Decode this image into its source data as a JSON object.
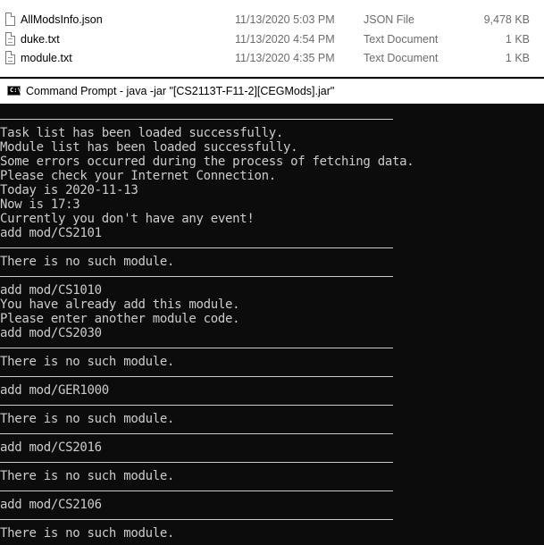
{
  "explorer": {
    "header_stub": "",
    "files": [
      {
        "name": "AllModsInfo.json",
        "modified": "11/13/2020 5:03 PM",
        "type": "JSON File",
        "size": "9,478 KB",
        "icon": "file-icon"
      },
      {
        "name": "duke.txt",
        "modified": "11/13/2020 4:54 PM",
        "type": "Text Document",
        "size": "1 KB",
        "icon": "text-file-icon"
      },
      {
        "name": "module.txt",
        "modified": "11/13/2020 4:35 PM",
        "type": "Text Document",
        "size": "1 KB",
        "icon": "text-file-icon"
      }
    ]
  },
  "window": {
    "title": "Command Prompt - java  -jar \"[CS2113T-F11-2][CEGMods].jar\"",
    "icon_text": "C:\\",
    "icon": "command-prompt-icon"
  },
  "console": {
    "lines": [
      {
        "kind": "sep",
        "text": ""
      },
      {
        "kind": "text",
        "text": "Task list has been loaded successfully."
      },
      {
        "kind": "text",
        "text": "Module list has been loaded successfully."
      },
      {
        "kind": "text",
        "text": "Some errors occurred during the process of fetching data."
      },
      {
        "kind": "text",
        "text": "Please check your Internet Connection."
      },
      {
        "kind": "text",
        "text": "Today is 2020-11-13"
      },
      {
        "kind": "text",
        "text": "Now is 17:3"
      },
      {
        "kind": "text",
        "text": "Currently you don't have any event!"
      },
      {
        "kind": "text",
        "text": "add mod/CS2101"
      },
      {
        "kind": "sep",
        "text": ""
      },
      {
        "kind": "text",
        "text": "There is no such module."
      },
      {
        "kind": "sep",
        "text": ""
      },
      {
        "kind": "text",
        "text": "add mod/CS1010"
      },
      {
        "kind": "text",
        "text": "You have already add this module."
      },
      {
        "kind": "text",
        "text": "Please enter another module code."
      },
      {
        "kind": "text",
        "text": "add mod/CS2030"
      },
      {
        "kind": "sep",
        "text": ""
      },
      {
        "kind": "text",
        "text": "There is no such module."
      },
      {
        "kind": "sep",
        "text": ""
      },
      {
        "kind": "text",
        "text": "add mod/GER1000"
      },
      {
        "kind": "sep",
        "text": ""
      },
      {
        "kind": "text",
        "text": "There is no such module."
      },
      {
        "kind": "sep",
        "text": ""
      },
      {
        "kind": "text",
        "text": "add mod/CS2016"
      },
      {
        "kind": "sep",
        "text": ""
      },
      {
        "kind": "text",
        "text": "There is no such module."
      },
      {
        "kind": "sep",
        "text": ""
      },
      {
        "kind": "text",
        "text": "add mod/CS2106"
      },
      {
        "kind": "sep",
        "text": ""
      },
      {
        "kind": "text",
        "text": "There is no such module."
      },
      {
        "kind": "sep",
        "text": ""
      }
    ]
  }
}
